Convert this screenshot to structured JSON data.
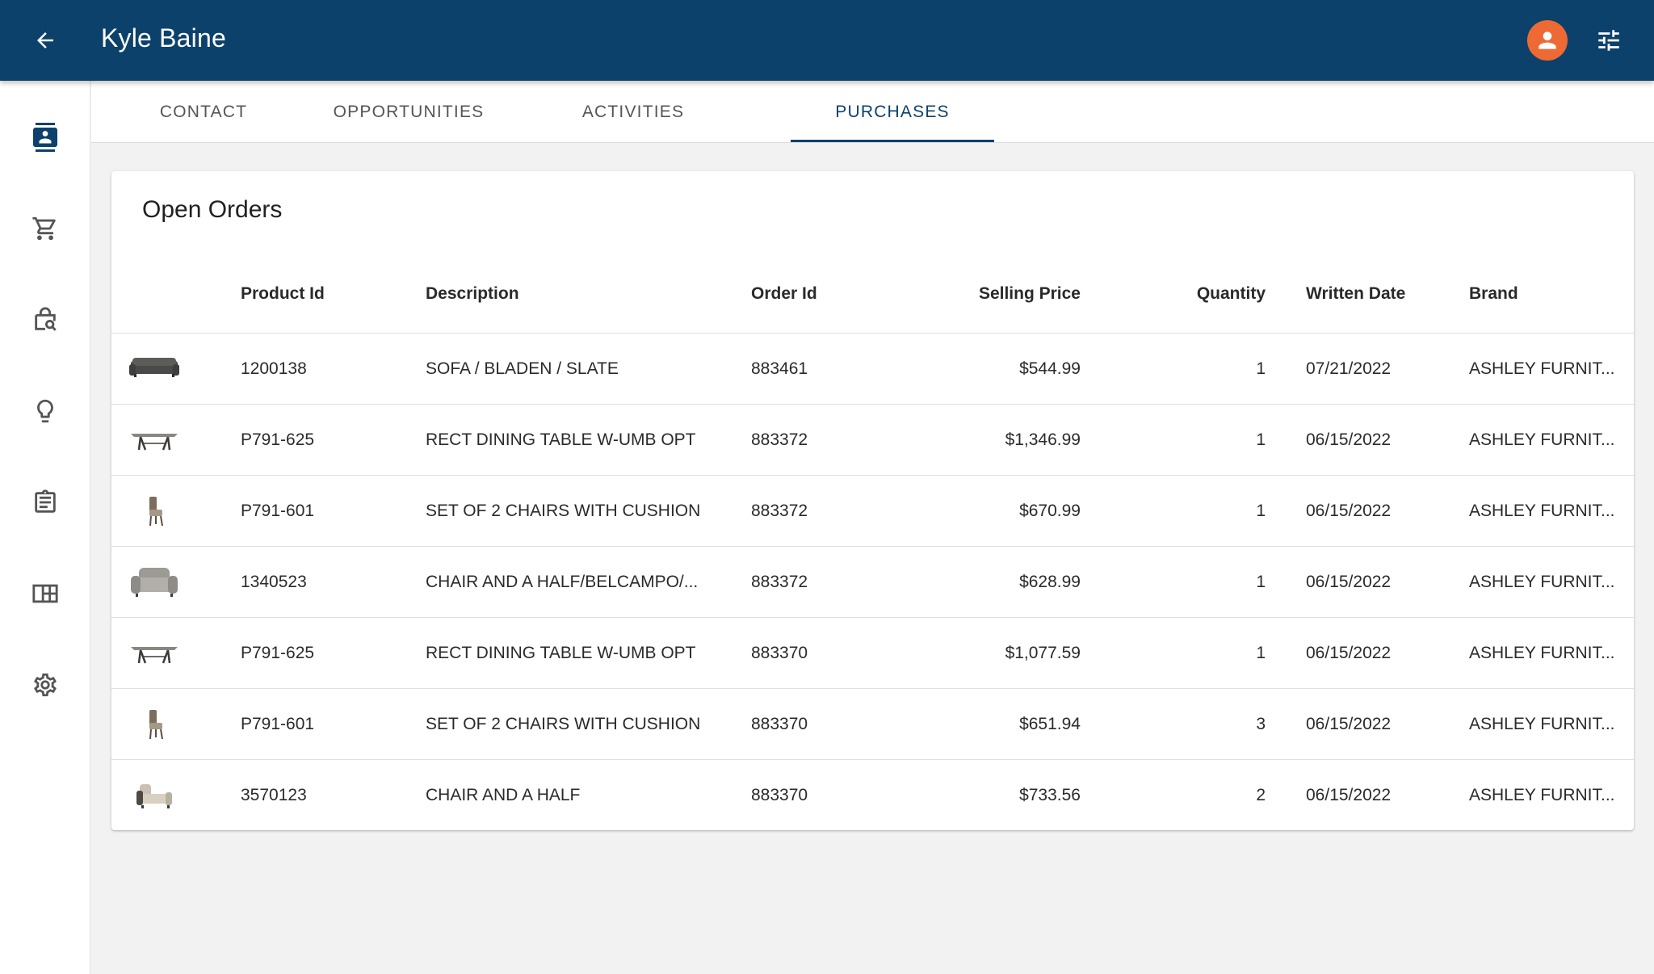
{
  "header": {
    "title": "Kyle Baine",
    "back_icon": "arrow-back-icon",
    "avatar_icon": "account-icon",
    "avatar_color": "#ee6a34",
    "settings_icon": "tune-icon",
    "bar_color": "#0c416c"
  },
  "sidebar": {
    "items": [
      {
        "icon": "contact-card-icon",
        "active": true
      },
      {
        "icon": "cart-icon",
        "active": false
      },
      {
        "icon": "shopping-bag-search-icon",
        "active": false
      },
      {
        "icon": "lightbulb-icon",
        "active": false
      },
      {
        "icon": "clipboard-icon",
        "active": false
      },
      {
        "icon": "table-grid-icon",
        "active": false
      },
      {
        "icon": "gear-icon",
        "active": false
      }
    ]
  },
  "tabs": [
    {
      "label": "CONTACT",
      "active": false
    },
    {
      "label": "OPPORTUNITIES",
      "active": false
    },
    {
      "label": "ACTIVITIES",
      "active": false
    },
    {
      "label": "PURCHASES",
      "active": true
    }
  ],
  "orders": {
    "title": "Open Orders",
    "columns": {
      "product_id": "Product Id",
      "description": "Description",
      "order_id": "Order Id",
      "selling_price": "Selling Price",
      "quantity": "Quantity",
      "written_date": "Written Date",
      "brand": "Brand"
    },
    "rows": [
      {
        "thumb": "sofa-image",
        "product_id": "1200138",
        "description": "SOFA / BLADEN / SLATE",
        "order_id": "883461",
        "selling_price": "$544.99",
        "quantity": "1",
        "written_date": "07/21/2022",
        "brand": "ASHLEY FURNIT..."
      },
      {
        "thumb": "dining-table-image",
        "product_id": "P791-625",
        "description": "RECT DINING TABLE W-UMB OPT",
        "order_id": "883372",
        "selling_price": "$1,346.99",
        "quantity": "1",
        "written_date": "06/15/2022",
        "brand": "ASHLEY FURNIT..."
      },
      {
        "thumb": "chairs-image",
        "product_id": "P791-601",
        "description": "SET OF 2 CHAIRS WITH CUSHION",
        "order_id": "883372",
        "selling_price": "$670.99",
        "quantity": "1",
        "written_date": "06/15/2022",
        "brand": "ASHLEY FURNIT..."
      },
      {
        "thumb": "armchair-image",
        "product_id": "1340523",
        "description": "CHAIR AND A HALF/BELCAMPO/...",
        "order_id": "883372",
        "selling_price": "$628.99",
        "quantity": "1",
        "written_date": "06/15/2022",
        "brand": "ASHLEY FURNIT..."
      },
      {
        "thumb": "dining-table-image",
        "product_id": "P791-625",
        "description": "RECT DINING TABLE W-UMB OPT",
        "order_id": "883370",
        "selling_price": "$1,077.59",
        "quantity": "1",
        "written_date": "06/15/2022",
        "brand": "ASHLEY FURNIT..."
      },
      {
        "thumb": "chairs-image",
        "product_id": "P791-601",
        "description": "SET OF 2 CHAIRS WITH CUSHION",
        "order_id": "883370",
        "selling_price": "$651.94",
        "quantity": "3",
        "written_date": "06/15/2022",
        "brand": "ASHLEY FURNIT..."
      },
      {
        "thumb": "chaise-chair-image",
        "product_id": "3570123",
        "description": "CHAIR AND A HALF",
        "order_id": "883370",
        "selling_price": "$733.56",
        "quantity": "2",
        "written_date": "06/15/2022",
        "brand": "ASHLEY FURNIT..."
      }
    ]
  }
}
